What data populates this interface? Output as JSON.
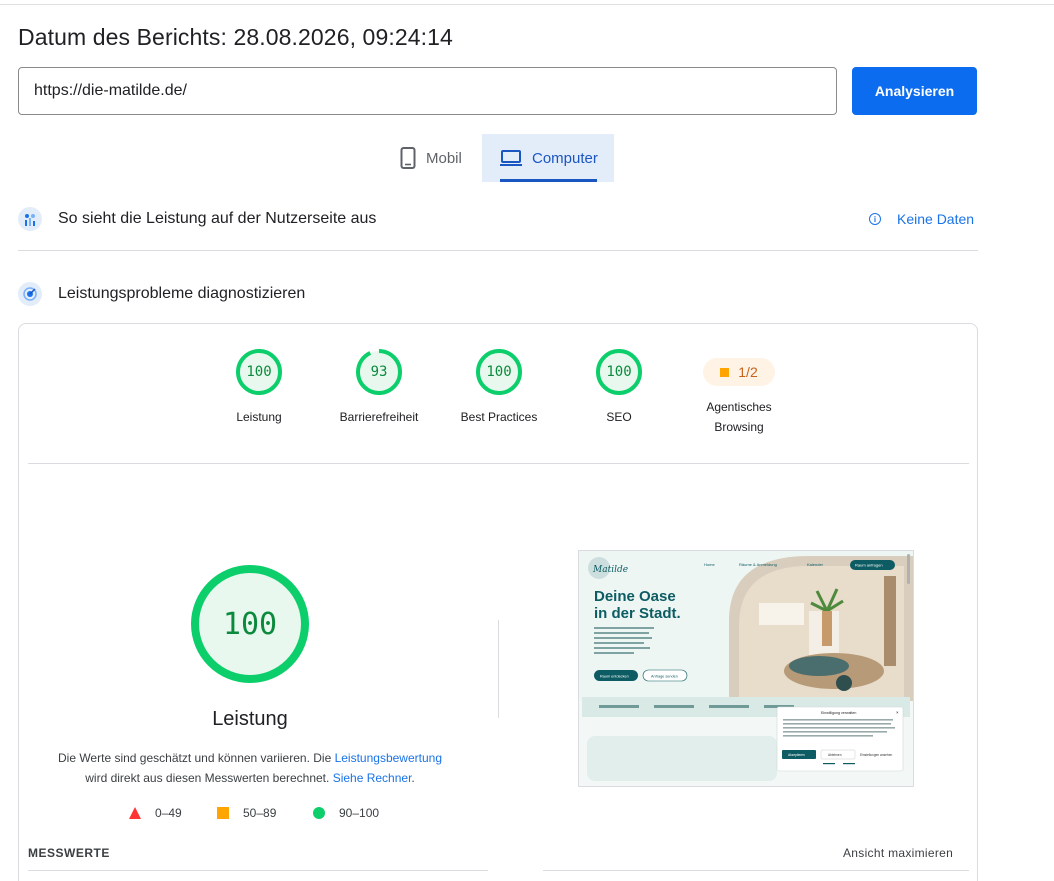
{
  "header": {
    "title": "Datum des Berichts: 28.08.2026, 09:24:14",
    "url_value": "https://die-matilde.de/",
    "analyze_label": "Analysieren"
  },
  "tabs": [
    {
      "label": "Mobil",
      "icon": "phone-icon",
      "selected": false
    },
    {
      "label": "Computer",
      "icon": "laptop-icon",
      "selected": true
    }
  ],
  "field_data": {
    "title": "So sieht die Leistung auf der Nutzerseite aus",
    "status": "Keine Daten"
  },
  "diagnose": {
    "title": "Leistungsprobleme diagnostizieren"
  },
  "categories": [
    {
      "label": "Leistung",
      "score": "100",
      "fraction": 1.0
    },
    {
      "label": "Barrierefreiheit",
      "score": "93",
      "fraction": 0.93
    },
    {
      "label": "Best Practices",
      "score": "100",
      "fraction": 1.0
    },
    {
      "label": "SEO",
      "score": "100",
      "fraction": 1.0
    }
  ],
  "agentic": {
    "label_line1": "Agentisches",
    "label_line2": "Browsing",
    "value": "1/2"
  },
  "performance": {
    "score": "100",
    "fraction": 1.0,
    "label": "Leistung",
    "note_part1": "Die Werte sind geschätzt und können variieren. Die ",
    "note_link1": "Leistungsbewertung",
    "note_part2": "wird direkt aus diesen Messwerten berechnet. ",
    "note_link2": "Siehe Rechner",
    "note_end": "."
  },
  "legend": [
    {
      "range": "0–49",
      "shape": "triangle",
      "color": "#ff3333"
    },
    {
      "range": "50–89",
      "shape": "square",
      "color": "#ffa400"
    },
    {
      "range": "90–100",
      "shape": "circle",
      "color": "#0cce6b"
    }
  ],
  "screenshot": {
    "logo": "Matilde",
    "nav": [
      "Home",
      "Räume & Anmeldung",
      "Kalender"
    ],
    "cta": "Raum anfragen",
    "headline1": "Deine Oase",
    "headline2": "in der Stadt.",
    "btn1": "Raum entdecken",
    "btn2": "Anfrage senden",
    "cookie_title": "Einwilligung verwalten",
    "cookie_accept": "Akzeptieren",
    "cookie_deny": "Ablehnen",
    "cookie_settings": "Einstellungen ansehen"
  },
  "metrics": {
    "title": "MESSWERTE",
    "expand": "Ansicht maximieren"
  },
  "colors": {
    "accent": "#0b6cf0",
    "pass": "#0cce6b",
    "pass_text": "#0b8a3d",
    "pass_bg": "#e8f8ee"
  }
}
